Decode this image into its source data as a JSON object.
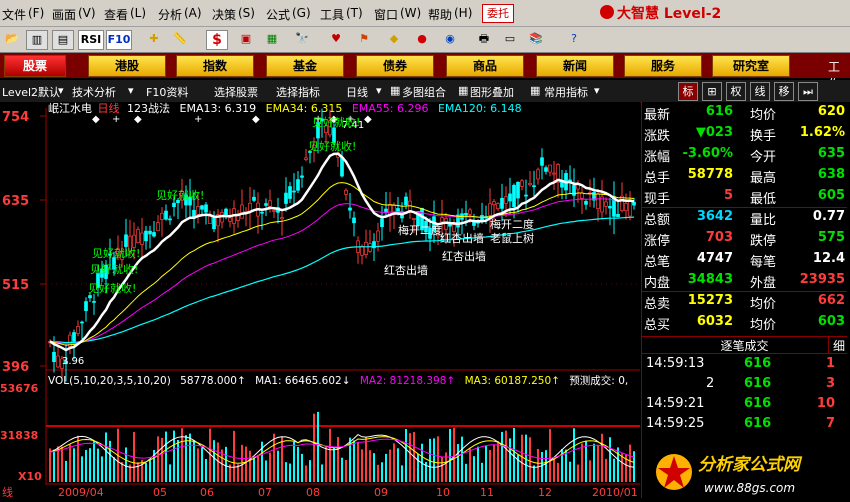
{
  "menu": [
    "文件",
    "画面",
    "查看",
    "分析",
    "决策",
    "公式",
    "工具",
    "窗口",
    "帮助"
  ],
  "cloud_button": "委托",
  "brand": "大智慧 Level-2",
  "toolbar": {
    "rsi": "RSI",
    "f": "F10",
    "s": "$"
  },
  "tabs": [
    "股票",
    "港股",
    "指数",
    "基金",
    "债券",
    "商品",
    "新闻",
    "服务",
    "研究室"
  ],
  "tab_extra": "工作",
  "subbar": {
    "items": [
      "Level2默认",
      "技术分析",
      "F10资料",
      "选择股票",
      "选择指标",
      "日线",
      "多图组合",
      "图形叠加",
      "常用指标"
    ],
    "right": [
      "标",
      "⊞",
      "权",
      "线",
      "移",
      "⏭"
    ]
  },
  "chart": {
    "stock": "岷江水电",
    "period": "日线",
    "method": "123战法",
    "ema": [
      {
        "label": "EMA13: 6.319",
        "color": "#ffffff"
      },
      {
        "label": "EMA34: 6.315",
        "color": "#ffff00"
      },
      {
        "label": "EMA55: 6.296",
        "color": "#ff00ff"
      },
      {
        "label": "EMA120: 6.148",
        "color": "#00ffff"
      }
    ],
    "yticks": [
      "754",
      "635",
      "515",
      "396"
    ],
    "low_marker": "3.96",
    "peak_marker": "7.41",
    "annotations": [
      {
        "text": "见好就收!",
        "color": "#00ff00"
      },
      {
        "text": "见好就收!",
        "color": "#00ff00"
      },
      {
        "text": "见好就收!",
        "color": "#00ff00"
      },
      {
        "text": "见好就收!",
        "color": "#00ff00"
      },
      {
        "text": "见好就收!",
        "color": "#00ff00"
      },
      {
        "text": "见好就收!",
        "color": "#00ff00"
      },
      {
        "text": "红杏出墙",
        "color": "#ffffff"
      },
      {
        "text": "红杏出墙",
        "color": "#ffffff"
      },
      {
        "text": "梅开二度",
        "color": "#ffffff"
      },
      {
        "text": "梅开二度",
        "color": "#ffffff"
      },
      {
        "text": "老鼠上树",
        "color": "#ffffff"
      },
      {
        "text": "红杏出墙",
        "color": "#ffffff"
      }
    ],
    "vol_title": "VOL(5,10,20,3,5,10,20)",
    "vol_value": "58778.000↑",
    "vol_ma": [
      {
        "label": "MA1: 66465.602↓",
        "color": "#ffffff"
      },
      {
        "label": "MA2: 81218.398↑",
        "color": "#ff00ff"
      },
      {
        "label": "MA3: 60187.250↑",
        "color": "#ffff00"
      }
    ],
    "vol_extra": "预测成交: 0,",
    "vol_yticks": [
      "53676",
      "31838",
      "X10"
    ],
    "xticks": [
      "2009/04",
      "05",
      "06",
      "07",
      "08",
      "09",
      "10",
      "11",
      "12",
      "2010/01"
    ]
  },
  "quote": {
    "rows": [
      {
        "l": "最新",
        "v1": "616",
        "c1": "green",
        "l2": "均价",
        "v2": "620",
        "c2": "yellow"
      },
      {
        "l": "涨跌",
        "v1": "▼023",
        "c1": "green",
        "l2": "换手",
        "v2": "1.62%",
        "c2": "yellow"
      },
      {
        "l": "涨幅",
        "v1": "-3.60%",
        "c1": "green",
        "l2": "今开",
        "v2": "635",
        "c2": "green"
      },
      {
        "l": "总手",
        "v1": "58778",
        "c1": "yellow",
        "l2": "最高",
        "v2": "638",
        "c2": "green"
      },
      {
        "l": "现手",
        "v1": "5",
        "c1": "red",
        "l2": "最低",
        "v2": "605",
        "c2": "green"
      },
      {
        "l": "总额",
        "v1": "3642",
        "c1": "cyan",
        "l2": "量比",
        "v2": "0.77",
        "c2": "white"
      },
      {
        "l": "涨停",
        "v1": "703",
        "c1": "red",
        "l2": "跌停",
        "v2": "575",
        "c2": "green"
      },
      {
        "l": "总笔",
        "v1": "4747",
        "c1": "white",
        "l2": "每笔",
        "v2": "12.4",
        "c2": "white"
      },
      {
        "l": "内盘",
        "v1": "34843",
        "c1": "green",
        "l2": "外盘",
        "v2": "23935",
        "c2": "red"
      },
      {
        "l": "总卖",
        "v1": "15273",
        "c1": "yellow",
        "l2": "均价",
        "v2": "662",
        "c2": "red"
      },
      {
        "l": "总买",
        "v1": "6032",
        "c1": "yellow",
        "l2": "均价",
        "v2": "603",
        "c2": "green"
      }
    ],
    "zbcj": "逐笔成交",
    "zbcj_btn": "细",
    "trades": [
      {
        "t": "14:59:13",
        "p": "616",
        "q": "1"
      },
      {
        "t": "2",
        "p": "616",
        "q": "3"
      },
      {
        "t": "14:59:21",
        "p": "616",
        "q": "10"
      },
      {
        "t": "14:59:25",
        "p": "616",
        "q": "7"
      }
    ]
  },
  "watermark": {
    "text": "分析家公式网",
    "url": "www.88gs.com"
  }
}
